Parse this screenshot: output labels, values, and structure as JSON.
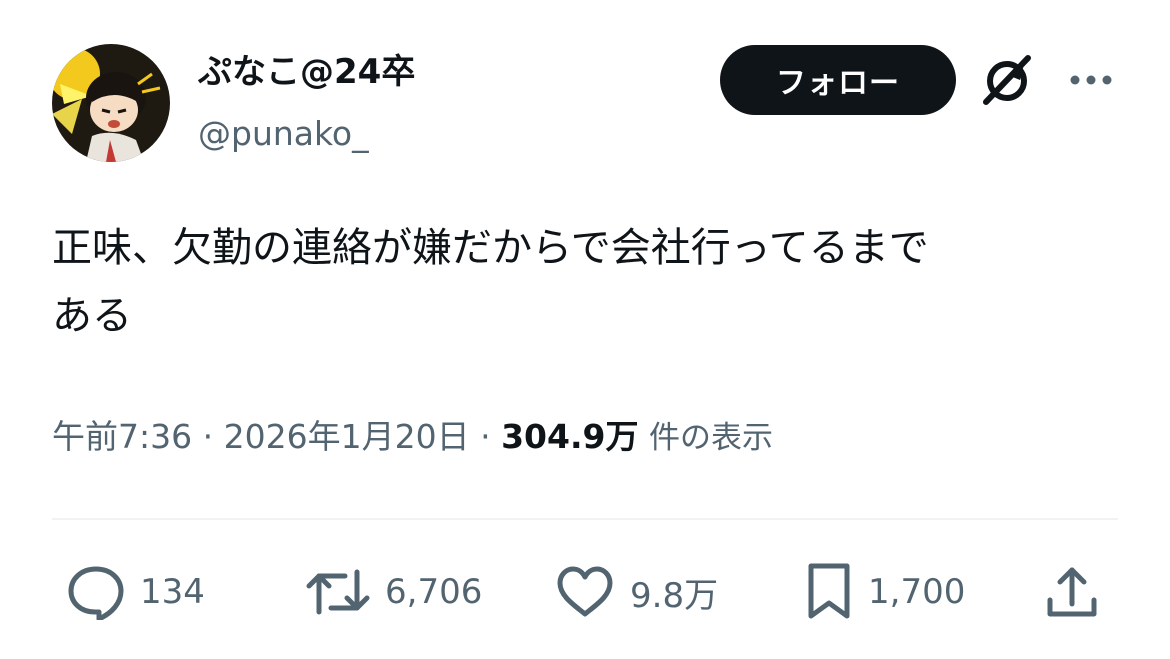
{
  "tweet": {
    "author": {
      "display_name": "ぷなこ@24卒",
      "handle": "@punako_"
    },
    "follow_label": "フォロー",
    "text_lines": [
      "正味、欠勤の連絡が嫌だからで会社行ってるまで",
      "ある"
    ],
    "time": "午前7:36",
    "separator": "·",
    "date": "2026年1月20日",
    "views_count": "304.9万",
    "views_label": "件の表示",
    "actions": {
      "replies": "134",
      "reposts": "6,706",
      "likes": "9.8万",
      "bookmarks": "1,700"
    }
  },
  "icons": {
    "grok": "grok-icon",
    "more": "more-dots-icon",
    "reply": "reply-bubble-icon",
    "repost": "repost-arrows-icon",
    "like": "heart-icon",
    "bookmark": "bookmark-icon",
    "share": "share-upload-icon"
  },
  "colors": {
    "text_primary": "#0f1419",
    "text_secondary": "#536471",
    "follow_bg": "#0f1419",
    "divider": "#eff3f4"
  }
}
